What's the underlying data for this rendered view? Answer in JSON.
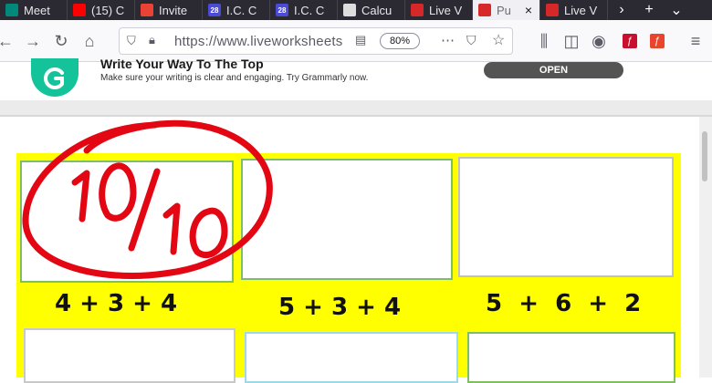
{
  "tabs": [
    {
      "label": "Meet",
      "fav_color": "#00897b"
    },
    {
      "label": "(15) C",
      "fav_color": "#ff0000"
    },
    {
      "label": "Invite",
      "fav_color": "#ea4335"
    },
    {
      "label": "I.C. C",
      "fav_color": "#4b4bd6",
      "fav_text": "28"
    },
    {
      "label": "I.C. C",
      "fav_color": "#4b4bd6",
      "fav_text": "28"
    },
    {
      "label": "Calcu",
      "fav_color": "#dddddd"
    },
    {
      "label": "Live V",
      "fav_color": "#d62828"
    },
    {
      "label": "Pu",
      "fav_color": "#d62828",
      "active": true
    },
    {
      "label": "Live V",
      "fav_color": "#d62828"
    }
  ],
  "navbar": {
    "url": "https://www.liveworksheets",
    "zoom": "80%"
  },
  "ad": {
    "title": "Write Your Way To The Top",
    "subtitle": "Make sure your writing is clear and engaging. Try Grammarly now.",
    "button": "OPEN"
  },
  "score": "10/10",
  "exercises": [
    "4 + 3 + 4",
    "5 + 3 + 4",
    "5  +  6  +  2"
  ],
  "colors": {
    "accent_yellow": "#ffff00",
    "ink_red": "#e30613",
    "grammarly_green": "#15c39a"
  }
}
